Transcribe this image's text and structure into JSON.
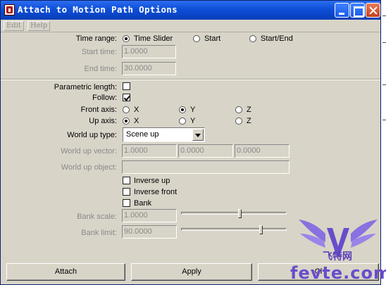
{
  "window": {
    "title": "Attach to Motion Path Options"
  },
  "menu": [
    {
      "label": "Edit"
    },
    {
      "label": "Help"
    }
  ],
  "time_range": {
    "label": "Time range:",
    "options": [
      {
        "label": "Time Slider",
        "selected": true
      },
      {
        "label": "Start",
        "selected": false
      },
      {
        "label": "Start/End",
        "selected": false
      }
    ],
    "start_time_label": "Start time:",
    "start_time_value": "1.0000",
    "end_time_label": "End time:",
    "end_time_value": "30.0000"
  },
  "parametric_length": {
    "label": "Parametric length:",
    "checked": false
  },
  "follow": {
    "label": "Follow:",
    "checked": true
  },
  "front_axis": {
    "label": "Front axis:",
    "options": [
      {
        "label": "X",
        "selected": false
      },
      {
        "label": "Y",
        "selected": true
      },
      {
        "label": "Z",
        "selected": false
      }
    ]
  },
  "up_axis": {
    "label": "Up axis:",
    "options": [
      {
        "label": "X",
        "selected": true
      },
      {
        "label": "Y",
        "selected": false
      },
      {
        "label": "Z",
        "selected": false
      }
    ]
  },
  "world_up_type": {
    "label": "World up type:",
    "value": "Scene up"
  },
  "world_up_vector": {
    "label": "World up vector:",
    "values": [
      "1.0000",
      "0.0000",
      "0.0000"
    ]
  },
  "world_up_object": {
    "label": "World up object:",
    "value": ""
  },
  "inverse_up": {
    "label": "Inverse up",
    "checked": false
  },
  "inverse_front": {
    "label": "Inverse front",
    "checked": false
  },
  "bank": {
    "label": "Bank",
    "checked": false
  },
  "bank_scale": {
    "label": "Bank scale:",
    "value": "1.0000",
    "slider_fraction": 0.56
  },
  "bank_limit": {
    "label": "Bank limit:",
    "value": "90.0000",
    "slider_fraction": 0.76
  },
  "buttons": {
    "attach": "Attach",
    "apply": "Apply",
    "close": "Cl"
  },
  "watermark": {
    "text": "fevte.com",
    "cn": "飞特网"
  },
  "colors": {
    "titlebar": "#0d4fd8",
    "dialog_bg": "#d8d4c8",
    "watermark": "#6a4ccc"
  }
}
